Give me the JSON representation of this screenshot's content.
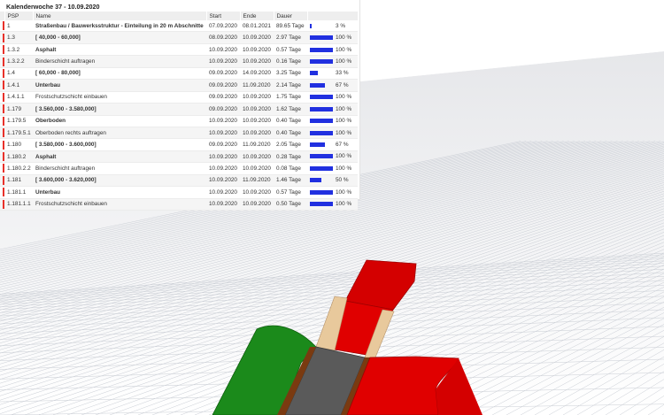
{
  "panel": {
    "title": "Kalenderwoche 37 - 10.09.2020",
    "columns": [
      "PSP",
      "Name",
      "Start",
      "Ende",
      "Dauer",
      ""
    ]
  },
  "colors": {
    "marker_red": "#e8312a",
    "progress_bar": "#2130e0",
    "road_green": "#1b8a1b",
    "road_red": "#d40000",
    "road_gray": "#5a5a5a",
    "road_tan": "#e8c99c",
    "road_brown": "#7a3a10",
    "grid_line": "#c9cdd4"
  },
  "rows": [
    {
      "psp": "1",
      "name": "Straßenbau / Bauwerksstruktur - Einteilung in 20 m Abschnitte",
      "bold": true,
      "start": "07.09.2020",
      "end": "08.01.2021",
      "duration": "89.65 Tage",
      "progress_label": "3 %",
      "progress": 3
    },
    {
      "psp": "1.3",
      "name": "[ 40,000 - 60,000]",
      "bold": true,
      "start": "08.09.2020",
      "end": "10.09.2020",
      "duration": "2.97 Tage",
      "progress_label": "100 %",
      "progress": 100
    },
    {
      "psp": "1.3.2",
      "name": "Asphalt",
      "bold": true,
      "start": "10.09.2020",
      "end": "10.09.2020",
      "duration": "0.57 Tage",
      "progress_label": "100 %",
      "progress": 100
    },
    {
      "psp": "1.3.2.2",
      "name": "Binderschicht auftragen",
      "bold": false,
      "start": "10.09.2020",
      "end": "10.09.2020",
      "duration": "0.16 Tage",
      "progress_label": "100 %",
      "progress": 100
    },
    {
      "psp": "1.4",
      "name": "[ 60,000 - 80,000]",
      "bold": true,
      "start": "09.09.2020",
      "end": "14.09.2020",
      "duration": "3.25 Tage",
      "progress_label": "33 %",
      "progress": 33
    },
    {
      "psp": "1.4.1",
      "name": "Unterbau",
      "bold": true,
      "start": "09.09.2020",
      "end": "11.09.2020",
      "duration": "2.14 Tage",
      "progress_label": "67 %",
      "progress": 67
    },
    {
      "psp": "1.4.1.1",
      "name": "Frostschutzschicht einbauen",
      "bold": false,
      "start": "09.09.2020",
      "end": "10.09.2020",
      "duration": "1.75 Tage",
      "progress_label": "100 %",
      "progress": 100
    },
    {
      "psp": "1.179",
      "name": "[ 3.560,000 - 3.580,000]",
      "bold": true,
      "start": "09.09.2020",
      "end": "10.09.2020",
      "duration": "1.62 Tage",
      "progress_label": "100 %",
      "progress": 100
    },
    {
      "psp": "1.179.5",
      "name": "Oberboden",
      "bold": true,
      "start": "10.09.2020",
      "end": "10.09.2020",
      "duration": "0.40 Tage",
      "progress_label": "100 %",
      "progress": 100
    },
    {
      "psp": "1.179.5.1",
      "name": "Oberboden rechts auftragen",
      "bold": false,
      "start": "10.09.2020",
      "end": "10.09.2020",
      "duration": "0.40 Tage",
      "progress_label": "100 %",
      "progress": 100
    },
    {
      "psp": "1.180",
      "name": "[ 3.580,000 - 3.600,000]",
      "bold": true,
      "start": "09.09.2020",
      "end": "11.09.2020",
      "duration": "2.05 Tage",
      "progress_label": "67 %",
      "progress": 67
    },
    {
      "psp": "1.180.2",
      "name": "Asphalt",
      "bold": true,
      "start": "10.09.2020",
      "end": "10.09.2020",
      "duration": "0.28 Tage",
      "progress_label": "100 %",
      "progress": 100
    },
    {
      "psp": "1.180.2.2",
      "name": "Binderschicht auftragen",
      "bold": false,
      "start": "10.09.2020",
      "end": "10.09.2020",
      "duration": "0.08 Tage",
      "progress_label": "100 %",
      "progress": 100
    },
    {
      "psp": "1.181",
      "name": "[ 3.600,000 - 3.620,000]",
      "bold": true,
      "start": "10.09.2020",
      "end": "11.09.2020",
      "duration": "1.46 Tage",
      "progress_label": "50 %",
      "progress": 50
    },
    {
      "psp": "1.181.1",
      "name": "Unterbau",
      "bold": true,
      "start": "10.09.2020",
      "end": "10.09.2020",
      "duration": "0.57 Tage",
      "progress_label": "100 %",
      "progress": 100
    },
    {
      "psp": "1.181.1.1",
      "name": "Frostschutzschicht einbauen",
      "bold": false,
      "start": "10.09.2020",
      "end": "10.09.2020",
      "duration": "0.50 Tage",
      "progress_label": "100 %",
      "progress": 100
    }
  ]
}
